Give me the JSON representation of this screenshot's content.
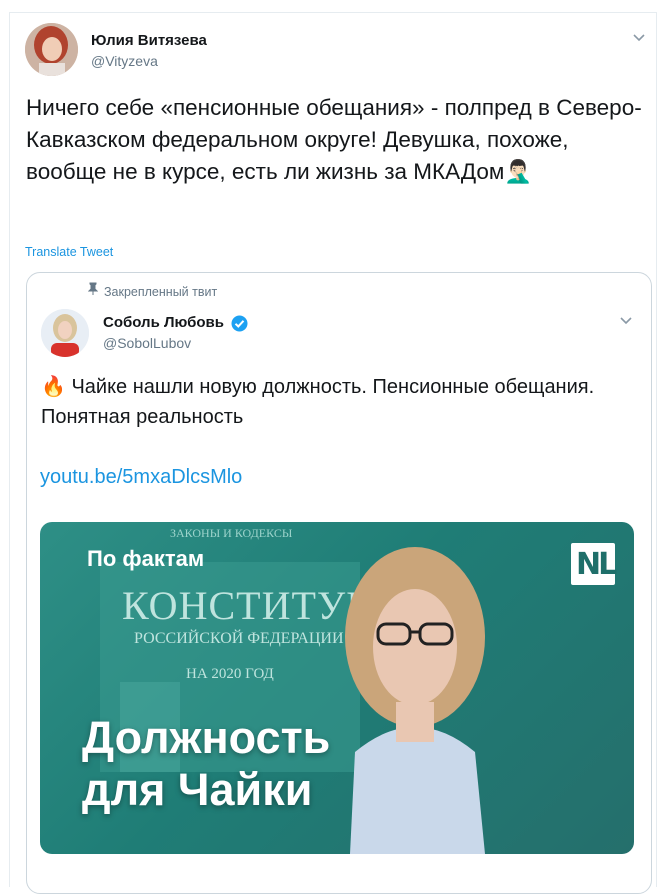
{
  "tweet": {
    "author_name": "Юлия Витязева",
    "author_handle": "@Vityzeva",
    "text": "Ничего себе «пенсионные обещания» - полпред в Северо-Кавказском федеральном округе! Девушка, похоже, вообще не в курсе, есть ли жизнь за МКАДом🤦🏻‍♂️",
    "translate_label": "Translate Tweet"
  },
  "quoted": {
    "pinned_label": "Закрепленный твит",
    "author_name": "Соболь Любовь",
    "author_handle": "@SobolLubov",
    "text": "🔥 Чайке нашли новую должность. Пенсионные обещания. Понятная реальность",
    "link": "youtu.be/5mxaDlcsMlo",
    "media": {
      "tag": "По фактам",
      "logo": "NL",
      "headline_line1": "Должность",
      "headline_line2": "для Чайки",
      "book_top": "ЗАКОНЫ И КОДЕКСЫ",
      "book_title": "КОНСТИТУЦИЯ",
      "book_sub": "РОССИЙСКОЙ ФЕДЕРАЦИИ",
      "book_year": "НА 2020 ГОД"
    }
  },
  "icons": [
    "chevron-down-icon",
    "pin-icon",
    "verified-badge-icon"
  ],
  "colors": {
    "link": "#1b95e0",
    "verified": "#1da1f2",
    "thumb_bg": "#2a857e"
  }
}
